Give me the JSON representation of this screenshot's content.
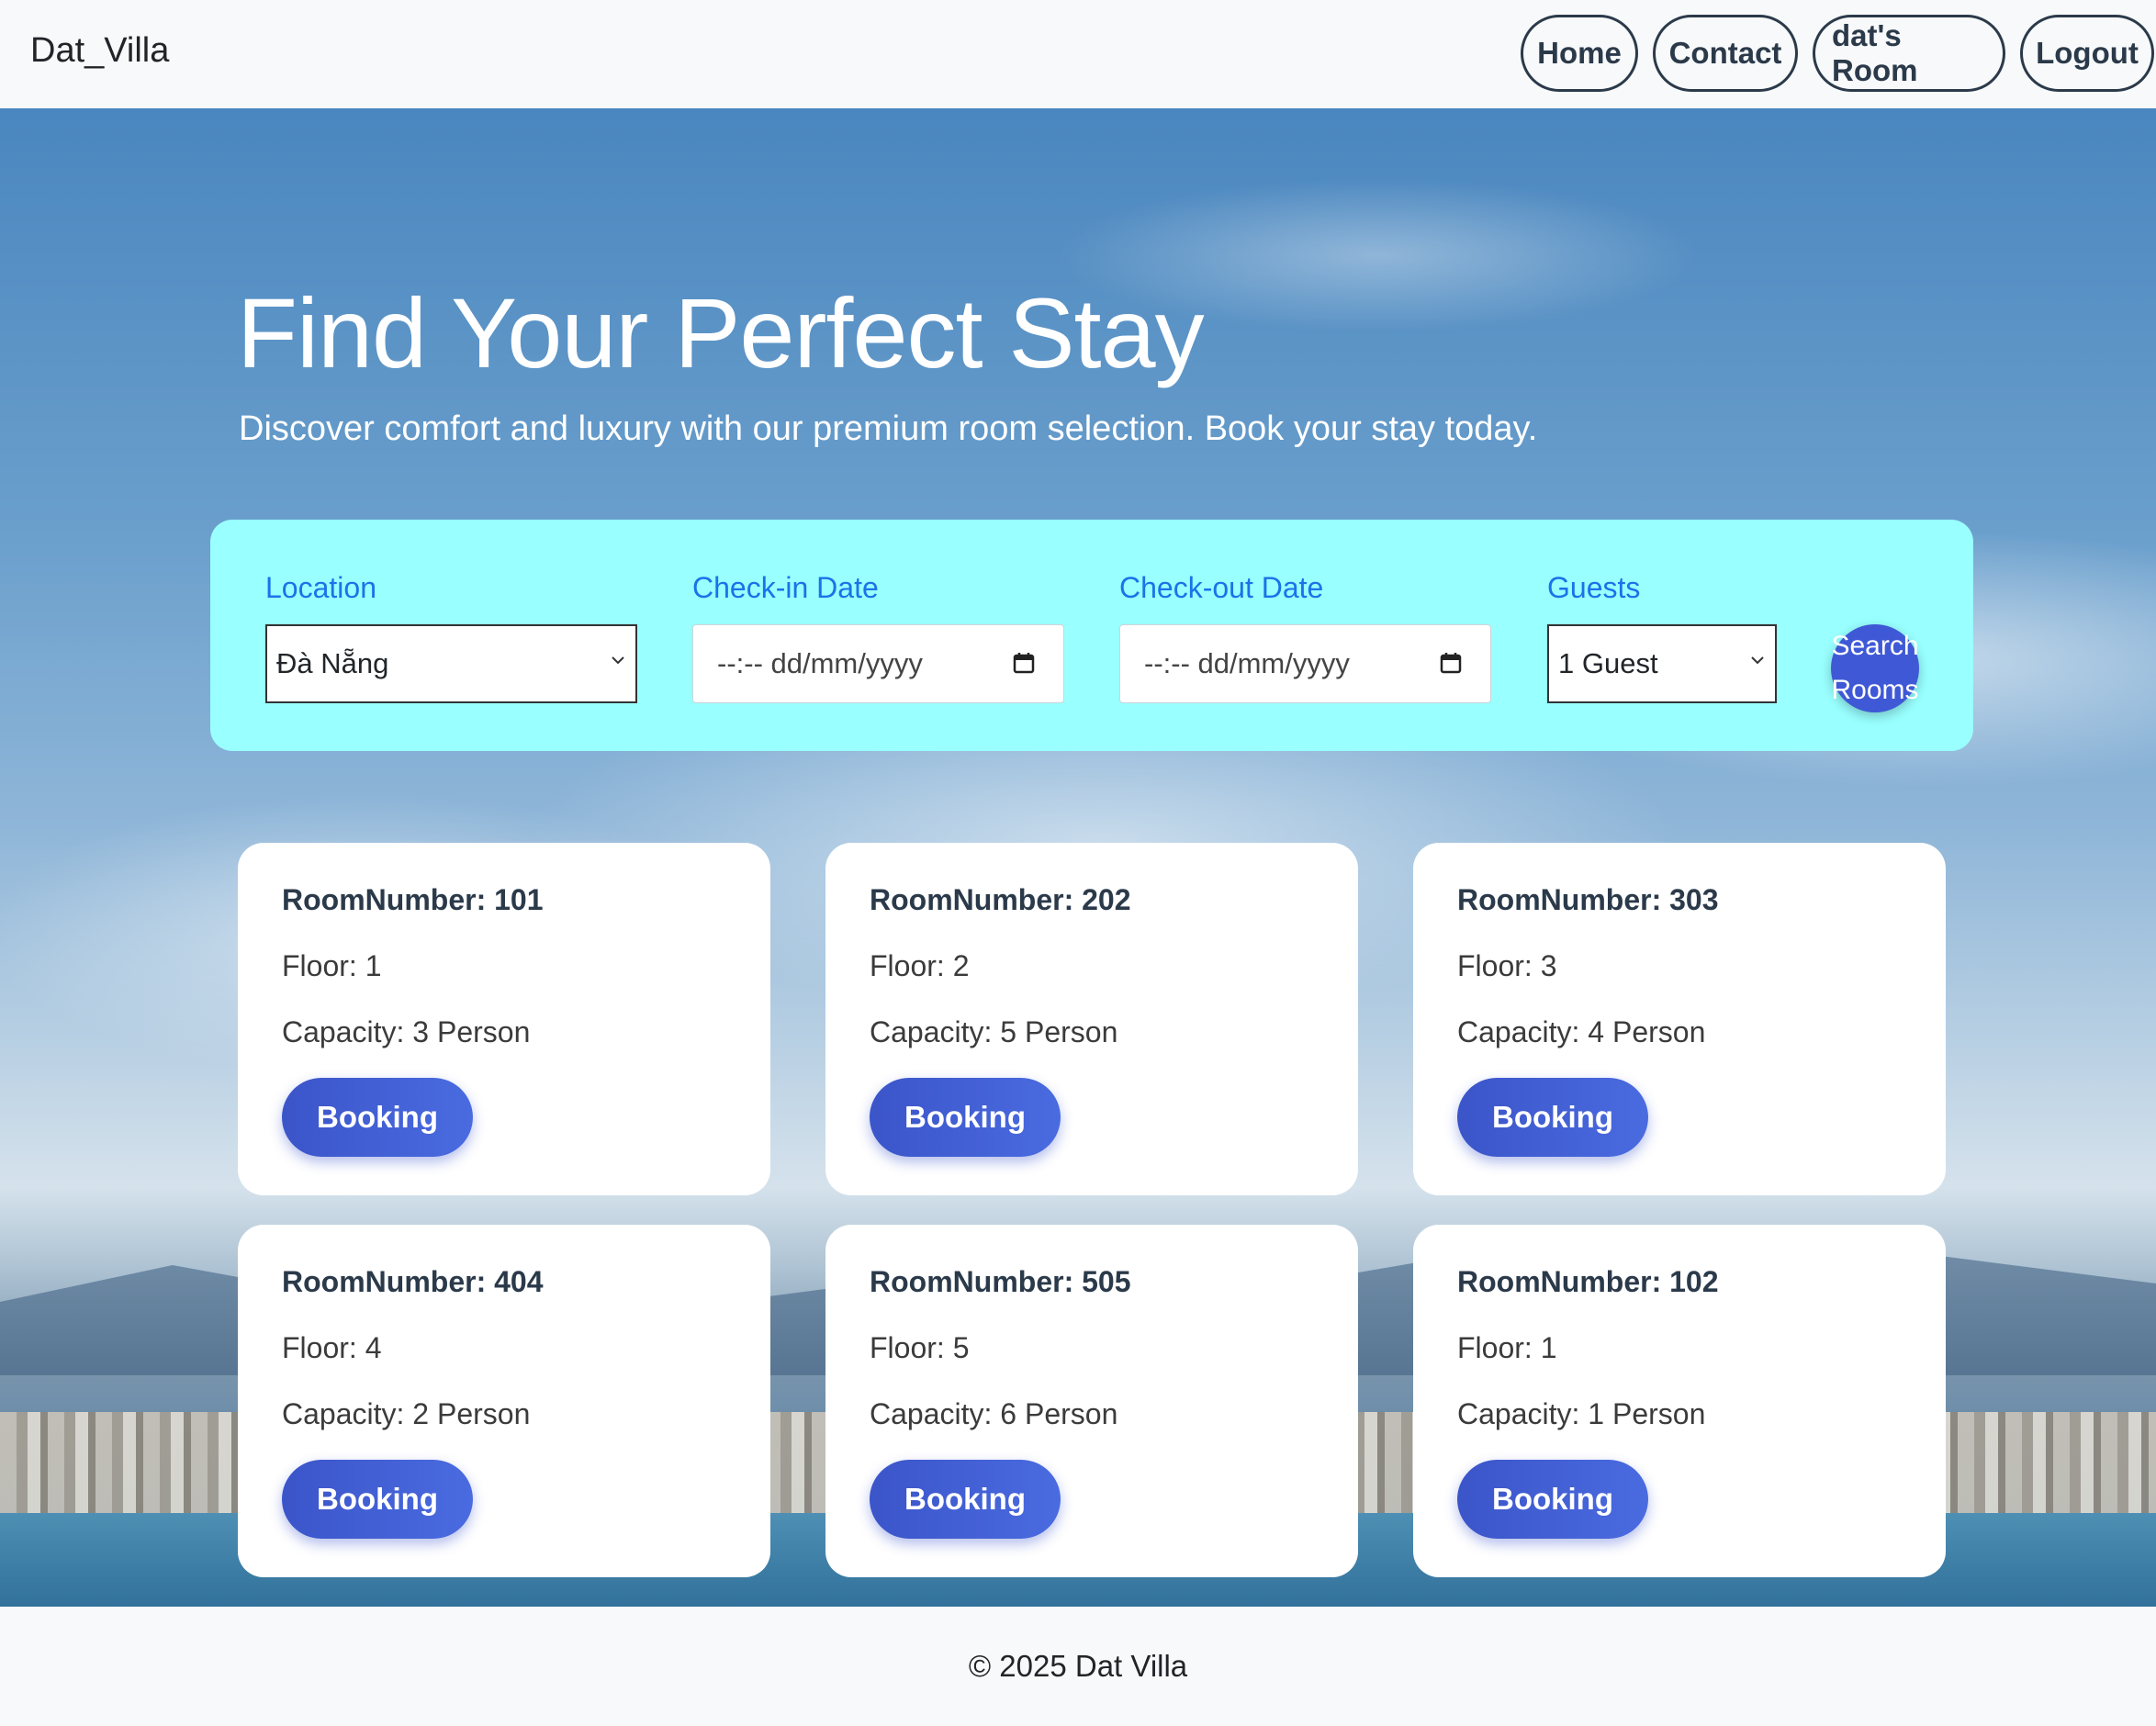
{
  "brand": "Dat_Villa",
  "nav": [
    {
      "label": "Home"
    },
    {
      "label": "Contact"
    },
    {
      "label": "dat's Room"
    },
    {
      "label": "Logout"
    }
  ],
  "hero": {
    "title": "Find Your Perfect Stay",
    "subtitle": "Discover comfort and luxury with our premium room selection. Book your stay today."
  },
  "search": {
    "location_label": "Location",
    "location_value": "Đà Nẵng",
    "checkin_label": "Check-in Date",
    "checkin_placeholder": "--:-- dd/mm/yyyy",
    "checkout_label": "Check-out Date",
    "checkout_placeholder": "--:-- dd/mm/yyyy",
    "guests_label": "Guests",
    "guests_value": "1 Guest",
    "button_line1": "Search",
    "button_line2": "Rooms"
  },
  "rooms": [
    {
      "number": "RoomNumber: 101",
      "floor": "Floor: 1",
      "capacity": "Capacity: 3 Person",
      "button": "Booking"
    },
    {
      "number": "RoomNumber: 202",
      "floor": "Floor: 2",
      "capacity": "Capacity: 5 Person",
      "button": "Booking"
    },
    {
      "number": "RoomNumber: 303",
      "floor": "Floor: 3",
      "capacity": "Capacity: 4 Person",
      "button": "Booking"
    },
    {
      "number": "RoomNumber: 404",
      "floor": "Floor: 4",
      "capacity": "Capacity: 2 Person",
      "button": "Booking"
    },
    {
      "number": "RoomNumber: 505",
      "floor": "Floor: 5",
      "capacity": "Capacity: 6 Person",
      "button": "Booking"
    },
    {
      "number": "RoomNumber: 102",
      "floor": "Floor: 1",
      "capacity": "Capacity: 1 Person",
      "button": "Booking"
    }
  ],
  "footer": "© 2025 Dat Villa",
  "colors": {
    "search_panel": "#99ffff",
    "label": "#1a73e8",
    "primary_button": "#3f59d6",
    "nav_border": "#2b3a4a"
  },
  "icons": [
    "chevron-down-icon",
    "calendar-icon"
  ]
}
